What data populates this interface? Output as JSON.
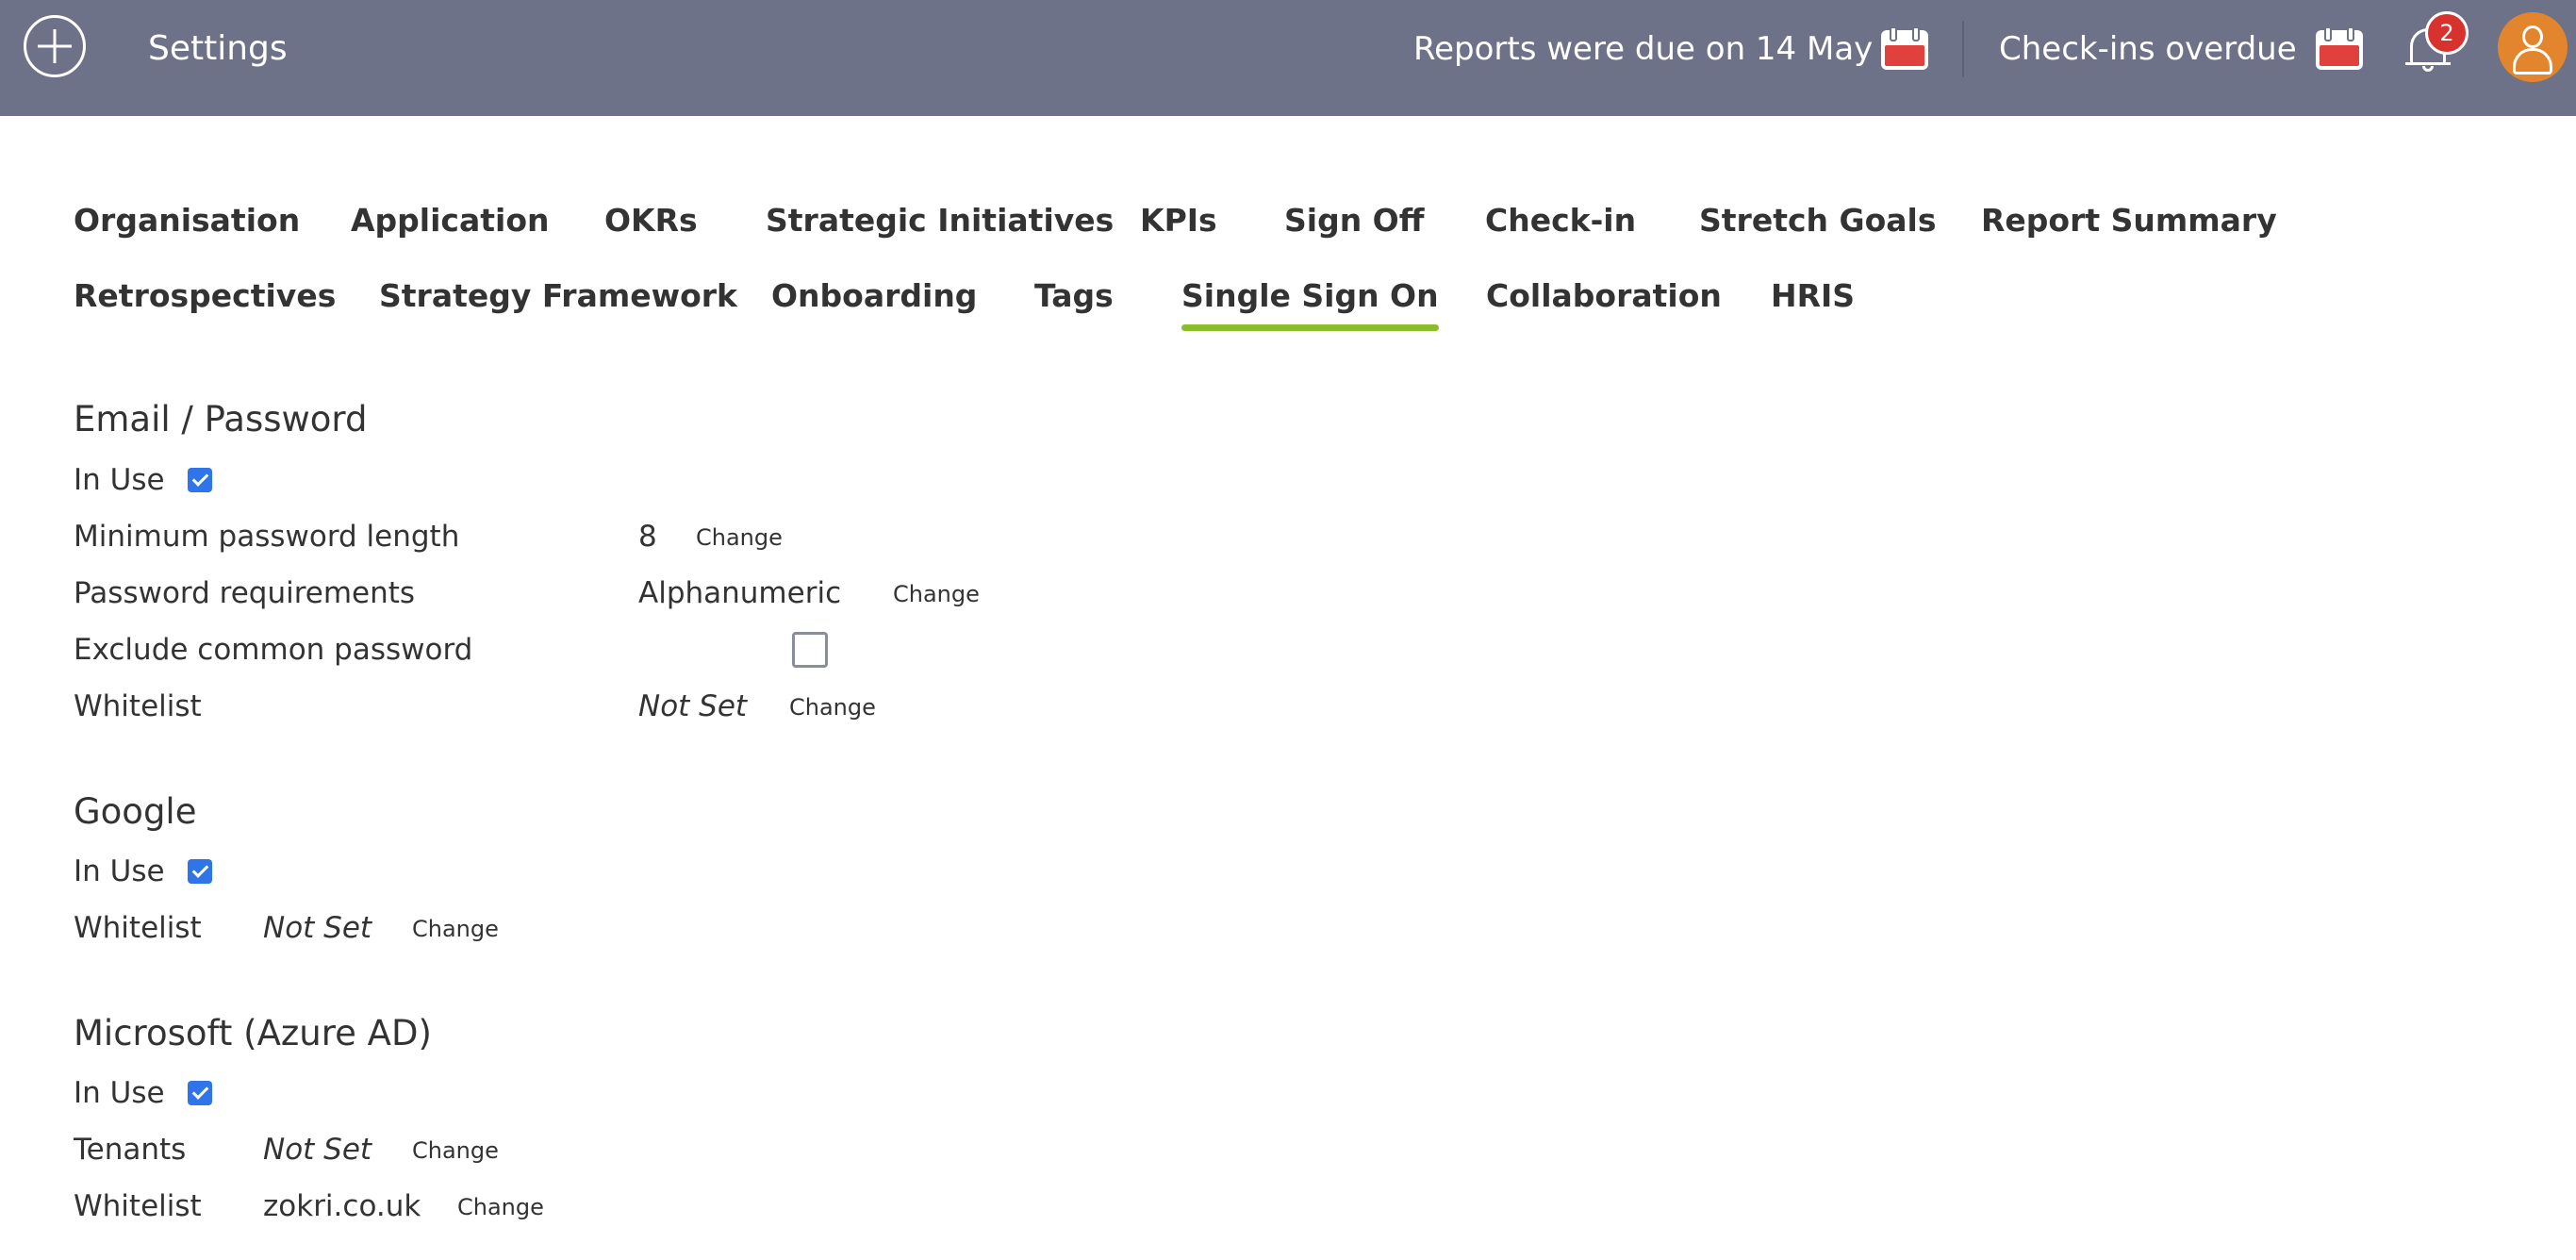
{
  "header": {
    "title": "Settings",
    "reports_due": "Reports were due on 14 May",
    "checkins_overdue": "Check-ins overdue",
    "notification_count": "2",
    "icons": [
      "add-icon",
      "calendar-icon",
      "calendar-icon",
      "bell-icon",
      "user-avatar-icon"
    ],
    "background_color": "#6e7289",
    "alert_color": "#e0413d",
    "avatar_color": "#e3852c"
  },
  "tabs": {
    "organisation": "Organisation",
    "application": "Application",
    "okrs": "OKRs",
    "strategic_initiatives": "Strategic Initiatives",
    "kpis": "KPIs",
    "sign_off": "Sign Off",
    "check_in": "Check-in",
    "stretch_goals": "Stretch Goals",
    "report_summary": "Report Summary",
    "retrospectives": "Retrospectives",
    "strategy_framework": "Strategy Framework",
    "onboarding": "Onboarding",
    "tags": "Tags",
    "single_sign_on": "Single Sign On",
    "collaboration": "Collaboration",
    "hris": "HRIS",
    "active": "Single Sign On",
    "active_underline_color": "#8bbd2a"
  },
  "email_password": {
    "title": "Email / Password",
    "in_use_label": "In Use",
    "in_use": true,
    "min_length_label": "Minimum password length",
    "min_length_value": "8",
    "requirements_label": "Password requirements",
    "requirements_value": "Alphanumeric",
    "exclude_common_label": "Exclude common password",
    "exclude_common": false,
    "whitelist_label": "Whitelist",
    "whitelist_value": "Not Set"
  },
  "google": {
    "title": "Google",
    "in_use_label": "In Use",
    "in_use": true,
    "whitelist_label": "Whitelist",
    "whitelist_value": "Not Set"
  },
  "microsoft": {
    "title": "Microsoft (Azure AD)",
    "in_use_label": "In Use",
    "in_use": true,
    "tenants_label": "Tenants",
    "tenants_value": "Not Set",
    "whitelist_label": "Whitelist",
    "whitelist_value": "zokri.co.uk"
  },
  "actions": {
    "change_label": "Change"
  },
  "checkbox_color": "#2f74e8"
}
